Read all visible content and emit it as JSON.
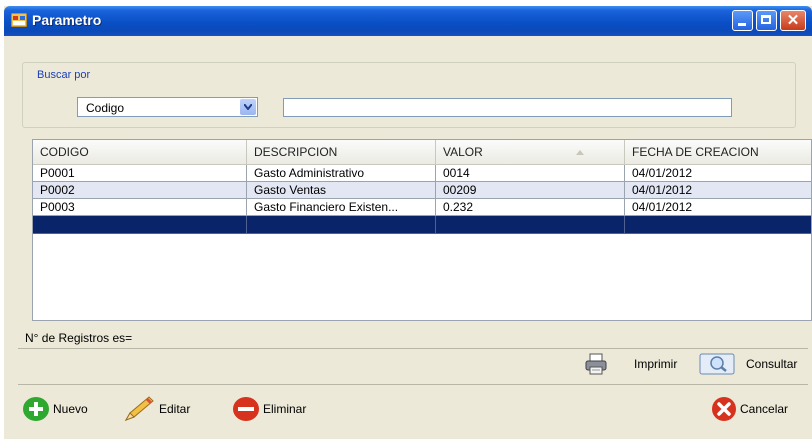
{
  "window": {
    "title": "Parametro"
  },
  "search": {
    "group_label": "Buscar por",
    "field_selected": "Codigo",
    "text_value": ""
  },
  "table": {
    "columns": [
      "CODIGO",
      "DESCRIPCION",
      "VALOR",
      "FECHA DE CREACION"
    ],
    "rows": [
      [
        "P0001",
        "Gasto Administrativo",
        "0014",
        "04/01/2012"
      ],
      [
        "P0002",
        "Gasto Ventas",
        "00209",
        "04/01/2012"
      ],
      [
        "P0003",
        "Gasto Financiero Existen...",
        "0.232",
        "04/01/2012"
      ],
      [
        "",
        "",
        "",
        ""
      ]
    ]
  },
  "status": {
    "record_count_label": "N° de Registros es="
  },
  "actions": {
    "print_label": "Imprimir",
    "query_label": "Consultar",
    "new_label": "Nuevo",
    "edit_label": "Editar",
    "delete_label": "Eliminar",
    "cancel_label": "Cancelar"
  },
  "icons": {
    "app": "app-window-icon",
    "minimize": "minimize-icon",
    "maximize": "maximize-icon",
    "close": "close-icon",
    "dropdown": "chevron-down-icon",
    "sort": "sort-ascending-icon",
    "print": "printer-icon",
    "query": "magnifier-icon",
    "new": "plus-circle-icon",
    "edit": "pencil-icon",
    "delete": "minus-circle-icon",
    "cancel": "x-circle-icon"
  },
  "colors": {
    "titlebar": "#0a4fc6",
    "window_bg": "#ece9d8",
    "selected_row": "#0a246a",
    "alt_row": "#e3e6f3",
    "group_label": "#1b3fb8"
  }
}
